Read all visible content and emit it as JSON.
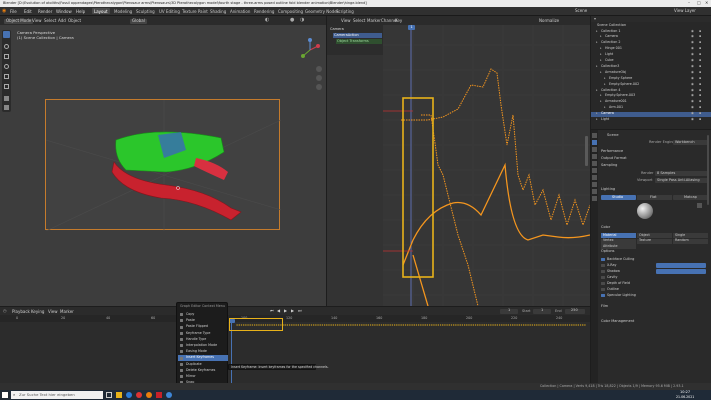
{
  "window": {
    "title": "Blender [D:\\Evolution of otoliths\\Fossil appendages\\Pterothecalygon\\Pterosaur arms\\Pterosaurs\\3D Pterothecalygon model\\fourth stage - three-arms posed outline fold blender animation\\Blender\\hinge.blend]"
  },
  "menubar": {
    "menus": [
      "File",
      "Edit",
      "Render",
      "Window",
      "Help"
    ],
    "workspaces": [
      "Layout",
      "Modeling",
      "Sculpting",
      "UV Editing",
      "Texture Paint",
      "Shading",
      "Animation",
      "Rendering",
      "Compositing",
      "Geometry Nodes",
      "Scripting"
    ],
    "active_workspace": "Layout",
    "scene": "Scene",
    "view_layer": "View Layer"
  },
  "viewport": {
    "mode": "Object Mode",
    "menus": [
      "View",
      "Select",
      "Add",
      "Object"
    ],
    "orientation": "Global",
    "overlay_line1": "Camera Perspective",
    "overlay_line2": "(1) Scene Collection | Camera"
  },
  "graph_editor": {
    "menus": [
      "View",
      "Select",
      "Marker",
      "Channel",
      "Key"
    ],
    "normalize": "Normalize",
    "channels": [
      "Camera",
      "CameraAction",
      "Object Transforms"
    ],
    "y_ticks": [
      "",
      "",
      "",
      "",
      "",
      "",
      "",
      "",
      "",
      "",
      "",
      "",
      ""
    ],
    "frame_marker": "1"
  },
  "outliner": {
    "title": "Scene Collection",
    "items": [
      "Collection 1",
      "Camera",
      "Collection 2",
      "Hinge 001",
      "Light",
      "Cube",
      "Collection3",
      "ArmatureObj",
      "Empty Sphere",
      "Empty.Sphere.002",
      "Collection 4",
      "Empty.Sphere.003",
      "Armature001",
      "Arm.001",
      "Camera",
      "Light"
    ]
  },
  "properties": {
    "title": "Scene",
    "render_engine_label": "Render Engine",
    "render_engine": "Workbench",
    "sections": [
      "Performance",
      "Output Format",
      "Sampling"
    ],
    "render_label": "Render",
    "render_value": "8 Samples",
    "viewport_label": "Viewport",
    "viewport_value": "Single Pass Anti-Aliasing",
    "lighting_header": "Lighting",
    "lighting_tabs": [
      "Studio",
      "Flat",
      "Matcap"
    ],
    "color_header": "Color",
    "color_options": [
      "Material",
      "Object",
      "Single",
      "Vertex",
      "Texture",
      "Random",
      "Attribute"
    ],
    "options_header": "Options",
    "options": [
      "Backface Culling",
      "X-Ray",
      "Shadow",
      "Cavity",
      "Depth of Field",
      "Outline",
      "Specular Lighting"
    ],
    "film_header": "Film",
    "color_management_header": "Color Management",
    "passes_label": "Passes",
    "format_label": "Format"
  },
  "timeline": {
    "playback": "Playback",
    "keying": "Keying",
    "menus": [
      "View",
      "Marker"
    ],
    "start_label": "Start",
    "start": "1",
    "end_label": "End",
    "end": "250",
    "current_frame": "1",
    "ruler": [
      "0",
      "20",
      "40",
      "60",
      "80",
      "100",
      "120",
      "140",
      "160",
      "180",
      "200",
      "220",
      "240"
    ]
  },
  "context_menu": {
    "title": "Graph Editor Context Menu",
    "items": [
      "Copy",
      "Paste",
      "Paste Flipped",
      "Keyframe Type",
      "Handle Type",
      "Interpolation Mode",
      "Easing Mode",
      "Insert Keyframes",
      "Duplicate",
      "Delete Keyframes",
      "Mirror",
      "Snap"
    ],
    "highlighted": "Insert Keyframes",
    "tooltip": "Insert Keyframe: Insert keyframes for the specified channels."
  },
  "statusbar": {
    "right": "Collection | Camera | Verts 9,418 | Tris 18,822 | Objects 1/9 | Memory 95.6 MiB | 2.93.1"
  },
  "taskbar": {
    "search_placeholder": "Zur Suche Text hier eingeben",
    "time": "10:27",
    "date": "21.06.2021"
  },
  "colors": {
    "accent": "#4772b3",
    "curve": "#f5961e",
    "highlight_box": "#e8b21a",
    "green_object": "#2bc62b",
    "red_object": "#c8222e"
  },
  "icons": [
    "search-icon",
    "windows-icon",
    "camera-icon",
    "light-icon",
    "mesh-icon",
    "eye-icon",
    "play-icon"
  ]
}
